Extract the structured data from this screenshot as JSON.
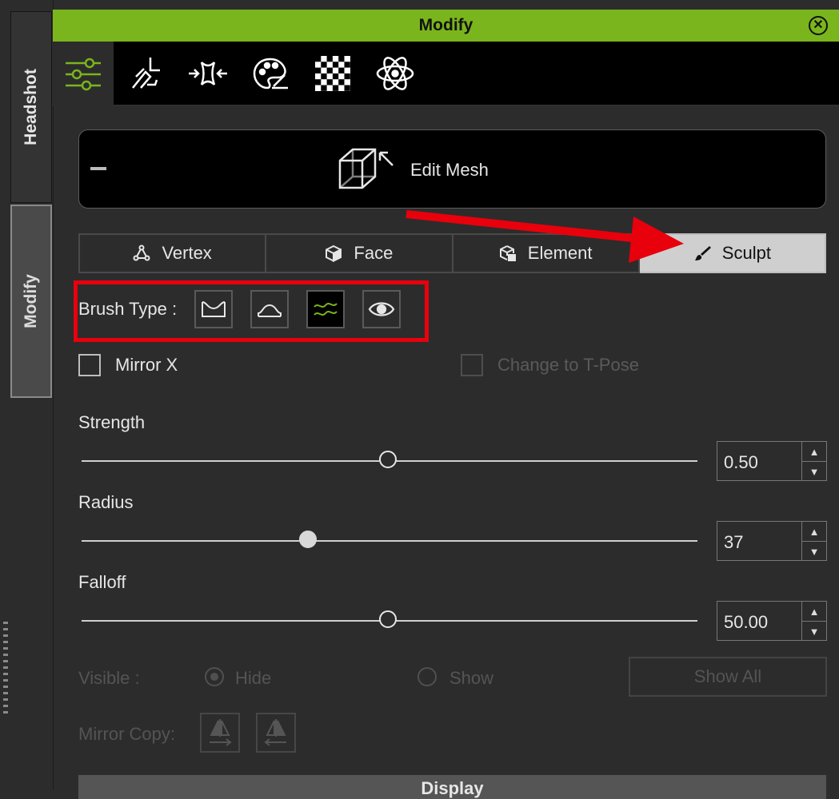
{
  "sidebar": {
    "tabs": [
      {
        "label": "Headshot",
        "active": false
      },
      {
        "label": "Modify",
        "active": true
      }
    ]
  },
  "panel": {
    "title": "Modify",
    "accent_color": "#7ab51d"
  },
  "toolbar": {
    "tools": [
      {
        "icon": "sliders-icon",
        "active": true
      },
      {
        "icon": "pose-figure-icon",
        "active": false
      },
      {
        "icon": "morph-compress-icon",
        "active": false
      },
      {
        "icon": "palette-icon",
        "active": false
      },
      {
        "icon": "checker-texture-icon",
        "active": false
      },
      {
        "icon": "atom-icon",
        "active": false
      }
    ]
  },
  "edit_mesh": {
    "label": "Edit Mesh",
    "icon": "mesh-cube-icon"
  },
  "mode_tabs": [
    {
      "label": "Vertex",
      "icon": "vertex-icon",
      "active": false
    },
    {
      "label": "Face",
      "icon": "face-cube-icon",
      "active": false
    },
    {
      "label": "Element",
      "icon": "element-cube-icon",
      "active": false
    },
    {
      "label": "Sculpt",
      "icon": "brush-icon",
      "active": true
    }
  ],
  "brush": {
    "label": "Brush Type :",
    "types": [
      {
        "icon": "push-brush-icon",
        "active": false
      },
      {
        "icon": "pull-brush-icon",
        "active": false
      },
      {
        "icon": "smooth-brush-icon",
        "active": true
      },
      {
        "icon": "eye-brush-icon",
        "active": false
      }
    ]
  },
  "options": {
    "mirror_x": {
      "label": "Mirror X",
      "checked": false
    },
    "t_pose": {
      "label": "Change to T-Pose",
      "checked": false,
      "enabled": false
    }
  },
  "sliders": {
    "strength": {
      "label": "Strength",
      "value": "0.50",
      "fraction": 0.5
    },
    "radius": {
      "label": "Radius",
      "value": "37",
      "fraction": 0.37
    },
    "falloff": {
      "label": "Falloff",
      "value": "50.00",
      "fraction": 0.5
    }
  },
  "visible": {
    "label": "Visible :",
    "hide_label": "Hide",
    "show_label": "Show",
    "selected": "Hide",
    "show_all_label": "Show All"
  },
  "mirror_copy": {
    "label": "Mirror Copy:"
  },
  "display_section": {
    "label": "Display"
  },
  "annotation": {
    "highlight_color": "#e8000c"
  }
}
